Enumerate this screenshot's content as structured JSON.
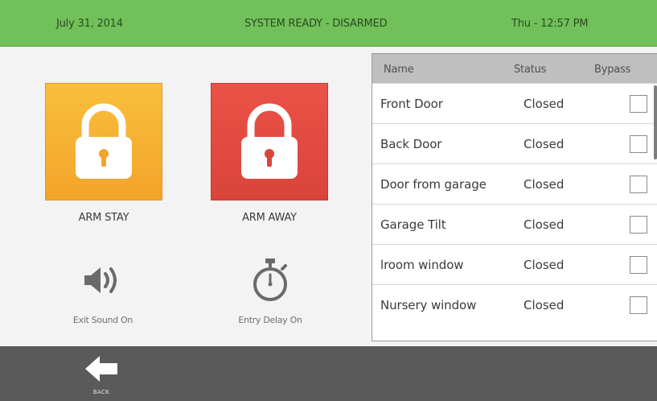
{
  "header": {
    "date": "July 31, 2014",
    "status": "SYSTEM READY - DISARMED",
    "time": "Thu - 12:57 PM",
    "color": "#72c05a"
  },
  "arm": {
    "stay": {
      "label": "ARM STAY",
      "color": "#f6b033",
      "icon": "lock-icon"
    },
    "away": {
      "label": "ARM AWAY",
      "color": "#e24c42",
      "icon": "lock-icon"
    }
  },
  "options": {
    "exit_sound": {
      "label": "Exit Sound On",
      "icon": "speaker-icon"
    },
    "entry_delay": {
      "label": "Entry Delay On",
      "icon": "stopwatch-icon"
    }
  },
  "zones": {
    "columns": [
      "Name",
      "Status",
      "Bypass"
    ],
    "rows": [
      {
        "name": "Front Door",
        "status": "Closed",
        "bypass": false
      },
      {
        "name": "Back Door",
        "status": "Closed",
        "bypass": false
      },
      {
        "name": "Door from garage",
        "status": "Closed",
        "bypass": false
      },
      {
        "name": "Garage Tilt",
        "status": "Closed",
        "bypass": false
      },
      {
        "name": "lroom window",
        "status": "Closed",
        "bypass": false
      },
      {
        "name": "Nursery window",
        "status": "Closed",
        "bypass": false
      }
    ]
  },
  "footer": {
    "back_label": "BACK",
    "back_icon": "arrow-left-icon"
  }
}
